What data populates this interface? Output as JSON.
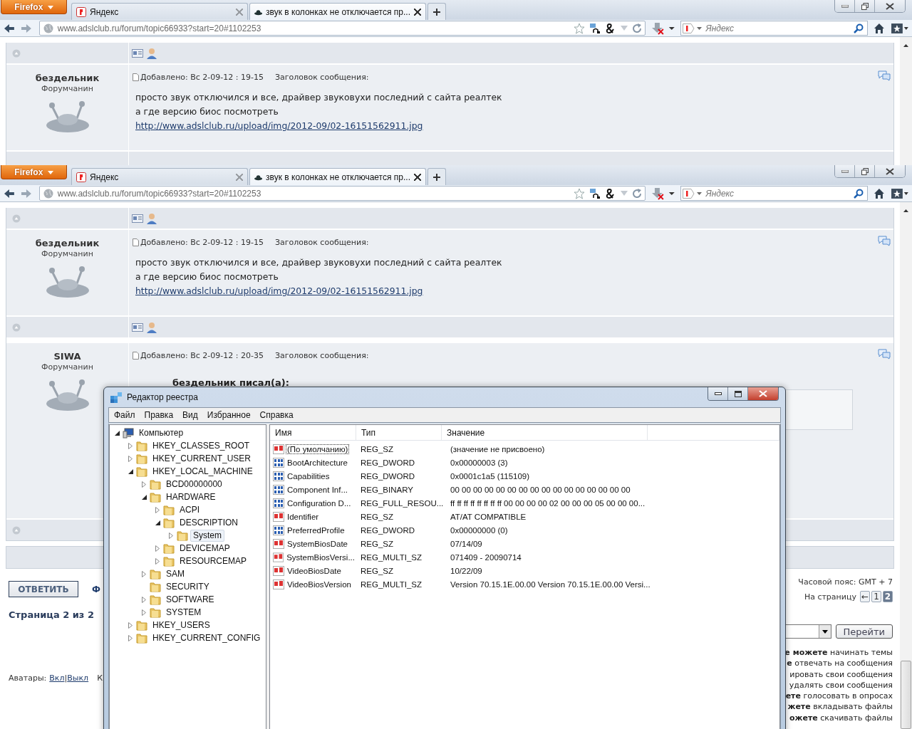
{
  "browser_windows": [
    {
      "app_menu": "Firefox",
      "tabs": [
        {
          "title": "Яндекс",
          "selected": false
        },
        {
          "title": "звук в колонках не отключается пр...",
          "selected": true
        }
      ],
      "address": "www.adslclub.ru/forum/topic66933?start=20#1102253",
      "search": {
        "placeholder": "Яндекс"
      },
      "posts": [
        {
          "author": "бездельник",
          "rank": "Форумчанин",
          "meta": "Добавлено: Вс 2-09-12 : 19-15",
          "subject_label": "Заголовок сообщения:",
          "body": [
            "просто звук отключился и все, драйвер звуковухи последний с сайта реалтек",
            "а где версию биос посмотреть"
          ],
          "link": "http://www.adslclub.ru/upload/img/2012-09/02-16151562911.jpg"
        }
      ]
    },
    {
      "app_menu": "Firefox",
      "tabs": [
        {
          "title": "Яндекс",
          "selected": false
        },
        {
          "title": "звук в колонках не отключается пр...",
          "selected": true
        }
      ],
      "address": "www.adslclub.ru/forum/topic66933?start=20#1102253",
      "search": {
        "placeholder": "Яндекс"
      },
      "posts": [
        {
          "author": "бездельник",
          "rank": "Форумчанин",
          "meta": "Добавлено: Вс 2-09-12 : 19-15",
          "subject_label": "Заголовок сообщения:",
          "body": [
            "просто звук отключился и все, драйвер звуковухи последний с сайта реалтек",
            "а где версию биос посмотреть"
          ],
          "link": "http://www.adslclub.ru/upload/img/2012-09/02-16151562911.jpg"
        },
        {
          "author": "SIWA",
          "rank": "Форумчанин",
          "meta": "Добавлено: Вс 2-09-12 : 20-35",
          "subject_label": "Заголовок сообщения:",
          "quote_author": "бездельник писал(а):"
        }
      ],
      "footer": {
        "reply_button": "ОТВЕТИТЬ",
        "reply_side_fragment": "Ф",
        "page_info": "Страница 2 из 2",
        "avatars_label": "Аватары:",
        "avatar_links": [
          "Вкл",
          "Выкл"
        ],
        "avatar_links_separator": "|",
        "avatars_side_fragment": "К",
        "timezone": "Часовой пояс: GMT + 7",
        "pages_label": "На страницу",
        "pages": [
          {
            "label": "←",
            "selected": false
          },
          {
            "label": "1",
            "selected": false
          },
          {
            "label": "2",
            "selected": true
          }
        ],
        "go_button": "Перейти",
        "permissions": [
          "**е можете** начинать темы",
          "**е** отвечать на сообщения",
          "ировать свои сообщения",
          "удалять свои сообщения",
          "**ете** голосовать в опросах",
          "**жете** вкладывать файлы",
          "**ожете** скачивать файлы"
        ]
      }
    }
  ],
  "registry_editor": {
    "title": "Редактор реестра",
    "menu": [
      "Файл",
      "Правка",
      "Вид",
      "Избранное",
      "Справка"
    ],
    "tree": [
      {
        "label": "Компьютер",
        "expandable": true,
        "expanded": true,
        "selected": false,
        "children": [
          {
            "label": "HKEY_CLASSES_ROOT",
            "expandable": true,
            "expanded": false,
            "selected": false
          },
          {
            "label": "HKEY_CURRENT_USER",
            "expandable": true,
            "expanded": false,
            "selected": false
          },
          {
            "label": "HKEY_LOCAL_MACHINE",
            "expandable": true,
            "expanded": true,
            "selected": false,
            "children": [
              {
                "label": "BCD00000000",
                "expandable": true,
                "expanded": false,
                "selected": false
              },
              {
                "label": "HARDWARE",
                "expandable": true,
                "expanded": true,
                "selected": false,
                "children": [
                  {
                    "label": "ACPI",
                    "expandable": true,
                    "expanded": false,
                    "selected": false
                  },
                  {
                    "label": "DESCRIPTION",
                    "expandable": true,
                    "expanded": true,
                    "selected": false,
                    "children": [
                      {
                        "label": "System",
                        "expandable": true,
                        "expanded": false,
                        "selected": true
                      }
                    ]
                  },
                  {
                    "label": "DEVICEMAP",
                    "expandable": true,
                    "expanded": false,
                    "selected": false
                  },
                  {
                    "label": "RESOURCEMAP",
                    "expandable": true,
                    "expanded": false,
                    "selected": false
                  }
                ]
              },
              {
                "label": "SAM",
                "expandable": true,
                "expanded": false,
                "selected": false
              },
              {
                "label": "SECURITY",
                "expandable": false,
                "selected": false
              },
              {
                "label": "SOFTWARE",
                "expandable": true,
                "expanded": false,
                "selected": false
              },
              {
                "label": "SYSTEM",
                "expandable": true,
                "expanded": false,
                "selected": false
              }
            ]
          },
          {
            "label": "HKEY_USERS",
            "expandable": true,
            "expanded": false,
            "selected": false
          },
          {
            "label": "HKEY_CURRENT_CONFIG",
            "expandable": true,
            "expanded": false,
            "selected": false
          }
        ]
      }
    ],
    "columns": [
      "Имя",
      "Тип",
      "Значение"
    ],
    "rows": [
      {
        "name": "(По умолчанию)",
        "type": "REG_SZ",
        "value": "(значение не присвоено)",
        "kind": "string",
        "focused": true
      },
      {
        "name": "BootArchitecture",
        "type": "REG_DWORD",
        "value": "0x00000003 (3)",
        "kind": "binary",
        "focused": false
      },
      {
        "name": "Capabilities",
        "type": "REG_DWORD",
        "value": "0x0001c1a5 (115109)",
        "kind": "binary",
        "focused": false
      },
      {
        "name": "Component Inf...",
        "type": "REG_BINARY",
        "value": "00 00 00 00 00 00 00 00 00 00 00 00 00 00 00 00",
        "kind": "binary",
        "focused": false
      },
      {
        "name": "Configuration D...",
        "type": "REG_FULL_RESOU...",
        "value": "ff ff ff ff ff ff ff ff 00 00 00 00 02 00 00 00 05 00 00 00...",
        "kind": "binary",
        "focused": false
      },
      {
        "name": "Identifier",
        "type": "REG_SZ",
        "value": "AT/AT COMPATIBLE",
        "kind": "string",
        "focused": false
      },
      {
        "name": "PreferredProfile",
        "type": "REG_DWORD",
        "value": "0x00000000 (0)",
        "kind": "binary",
        "focused": false
      },
      {
        "name": "SystemBiosDate",
        "type": "REG_SZ",
        "value": "07/14/09",
        "kind": "string",
        "focused": false
      },
      {
        "name": "SystemBiosVersi...",
        "type": "REG_MULTI_SZ",
        "value": "071409 - 20090714",
        "kind": "string",
        "focused": false
      },
      {
        "name": "VideoBiosDate",
        "type": "REG_SZ",
        "value": "10/22/09",
        "kind": "string",
        "focused": false
      },
      {
        "name": "VideoBiosVersion",
        "type": "REG_MULTI_SZ",
        "value": "Version 70.15.1E.00.00  Version 70.15.1E.00.00  Versi...",
        "kind": "string",
        "focused": false
      }
    ]
  }
}
